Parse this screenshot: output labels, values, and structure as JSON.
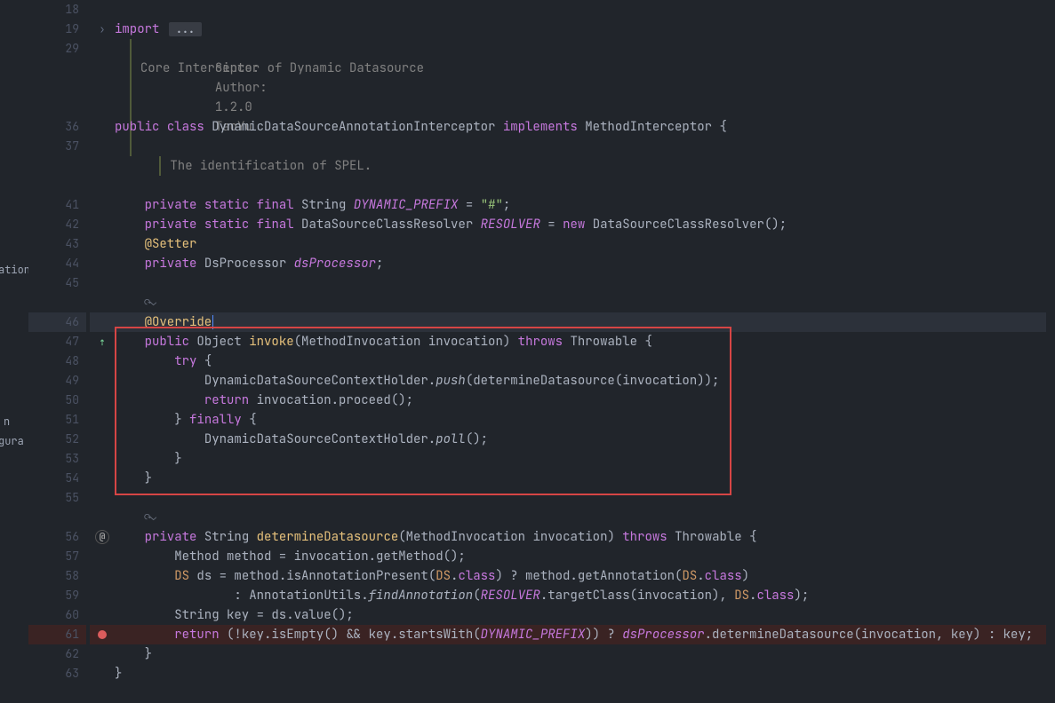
{
  "left_panel": {
    "items": [
      "ation",
      "n",
      "gura"
    ]
  },
  "doc_block1": {
    "l1": "Core Interceptor of Dynamic Datasource",
    "l2a": "Since:",
    "l2b": "1.2.0",
    "l3a": "Author:",
    "l3b": "TaoYu"
  },
  "doc_block2": {
    "l1": "The identification of SPEL."
  },
  "line19": {
    "import": "import",
    "fold": "..."
  },
  "line36": {
    "public": "public",
    "class_kw": "class",
    "class_name": "DynamicDataSourceAnnotationInterceptor",
    "implements": "implements",
    "iface": "MethodInterceptor",
    "brace": "{"
  },
  "line41": {
    "private": "private",
    "static": "static",
    "final": "final",
    "type": "String",
    "name": "DYNAMIC_PREFIX",
    "eq": "=",
    "val": "\"#\"",
    "semi": ";"
  },
  "line42": {
    "private": "private",
    "static": "static",
    "final": "final",
    "type": "DataSourceClassResolver",
    "name": "RESOLVER",
    "eq": "=",
    "new": "new",
    "ctor": "DataSourceClassResolver",
    "paren": "()",
    "semi": ";"
  },
  "line43": {
    "ann": "@Setter"
  },
  "line44": {
    "private": "private",
    "type": "DsProcessor",
    "name": "dsProcessor",
    "semi": ";"
  },
  "inlay1": {
    "txt": "⟳⌄"
  },
  "line46": {
    "ann": "@Override"
  },
  "line47": {
    "public": "public",
    "ret": "Object",
    "fn": "invoke",
    "sig_open": "(",
    "ptype": "MethodInvocation",
    "pname": "invocation",
    "sig_close": ")",
    "throws": "throws",
    "exc": "Throwable",
    "brace": "{"
  },
  "line48": {
    "try": "try",
    "brace": "{"
  },
  "line49": {
    "a": "DynamicDataSourceContextHolder.",
    "push": "push",
    "b": "(determineDatasource(invocation));"
  },
  "line50": {
    "ret": "return",
    "a": "invocation.proceed();"
  },
  "line51": {
    "brace": "}",
    "finally": "finally",
    "brace2": "{"
  },
  "line52": {
    "a": "DynamicDataSourceContextHolder.",
    "poll": "poll",
    "b": "();"
  },
  "line53": {
    "brace": "}"
  },
  "line54": {
    "brace": "}"
  },
  "inlay2": {
    "txt": "⟳⌄"
  },
  "line56": {
    "private": "private",
    "ret": "String",
    "fn": "determineDatasource",
    "sig_open": "(",
    "ptype": "MethodInvocation",
    "pname": "invocation",
    "sig_close": ")",
    "throws": "throws",
    "exc": "Throwable",
    "brace": "{"
  },
  "line57": {
    "a": "Method method = invocation.getMethod();"
  },
  "line58": {
    "ds": "DS",
    "a": " ds = method.isAnnotationPresent(",
    "dscls": "DS",
    "dot": ".",
    "class": "class",
    "b": ") ? method.getAnnotation(",
    "dscls2": "DS",
    "dot2": ".",
    "class2": "class",
    "c": ")"
  },
  "line59": {
    "a": ": AnnotationUtils.",
    "find": "findAnnotation",
    "b": "(",
    "resolver": "RESOLVER",
    "c": ".targetClass(invocation), ",
    "dscls": "DS",
    "dot": ".",
    "class": "class",
    "d": ");"
  },
  "line60": {
    "a": "String key = ds.value();"
  },
  "line61": {
    "ret": "return",
    "a": "(!key.isEmpty() && key.startsWith(",
    "pref": "DYNAMIC_PREFIX",
    "b": ")) ? ",
    "dsp": "dsProcessor",
    "c": ".determineDatasource(invocation, key) : key;"
  },
  "line62": {
    "brace": "}"
  },
  "line63": {
    "brace": "}"
  },
  "line_numbers": [
    "18",
    "19",
    "29",
    "",
    "",
    "",
    "36",
    "37",
    "",
    "",
    "41",
    "42",
    "43",
    "44",
    "45",
    "",
    "46",
    "47",
    "48",
    "49",
    "50",
    "51",
    "52",
    "53",
    "54",
    "55",
    "",
    "56",
    "57",
    "58",
    "59",
    "60",
    "61",
    "62",
    "63"
  ],
  "gutter_icons": {
    "fold_open": "›",
    "diff47": "⇡",
    "annot56": "@"
  }
}
